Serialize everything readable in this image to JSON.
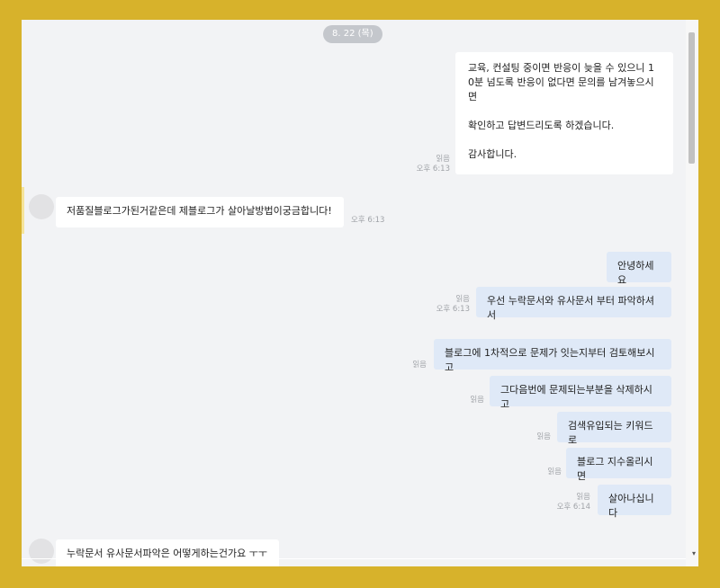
{
  "date_label": "8. 22 (목)",
  "messages": [
    {
      "text": "교육, 컨설팅 중이면 반응이 늦을 수 있으니 1\n0분 넘도록 반응이 없다면 문의를 남겨놓으시\n면\n\n확인하고 답변드리도록 하겠습니다.\n\n감사합니다.",
      "read": "읽음",
      "time": "오후 6:13"
    },
    {
      "text": "저품질블로그가된거같은데 제블로그가 살아날방법이궁금합니다!",
      "read": "",
      "time": "오후 6:13"
    },
    {
      "text": "안녕하세요",
      "read": "",
      "time": ""
    },
    {
      "text": "우선 누락문서와 유사문서 부터 파악하셔서",
      "read": "읽음",
      "time": "오후 6:13"
    },
    {
      "text": "블로그에 1차적으로 문제가 잇는지부터 검토해보시고",
      "read": "읽음",
      "time": ""
    },
    {
      "text": "그다음번에 문제되는부분을 삭제하시고",
      "read": "읽음",
      "time": ""
    },
    {
      "text": "검색유입되는 키워드로",
      "read": "읽음",
      "time": ""
    },
    {
      "text": "블로그 지수올리시면",
      "read": "읽음",
      "time": ""
    },
    {
      "text": "살아나십니다",
      "read": "읽음",
      "time": "오후 6:14"
    },
    {
      "text": "누락문서 유사문서파악은 어떻게하는건가요 ㅜㅜ",
      "read": "",
      "time": ""
    }
  ],
  "scrollbar": {
    "down_arrow_glyph": "▾"
  }
}
